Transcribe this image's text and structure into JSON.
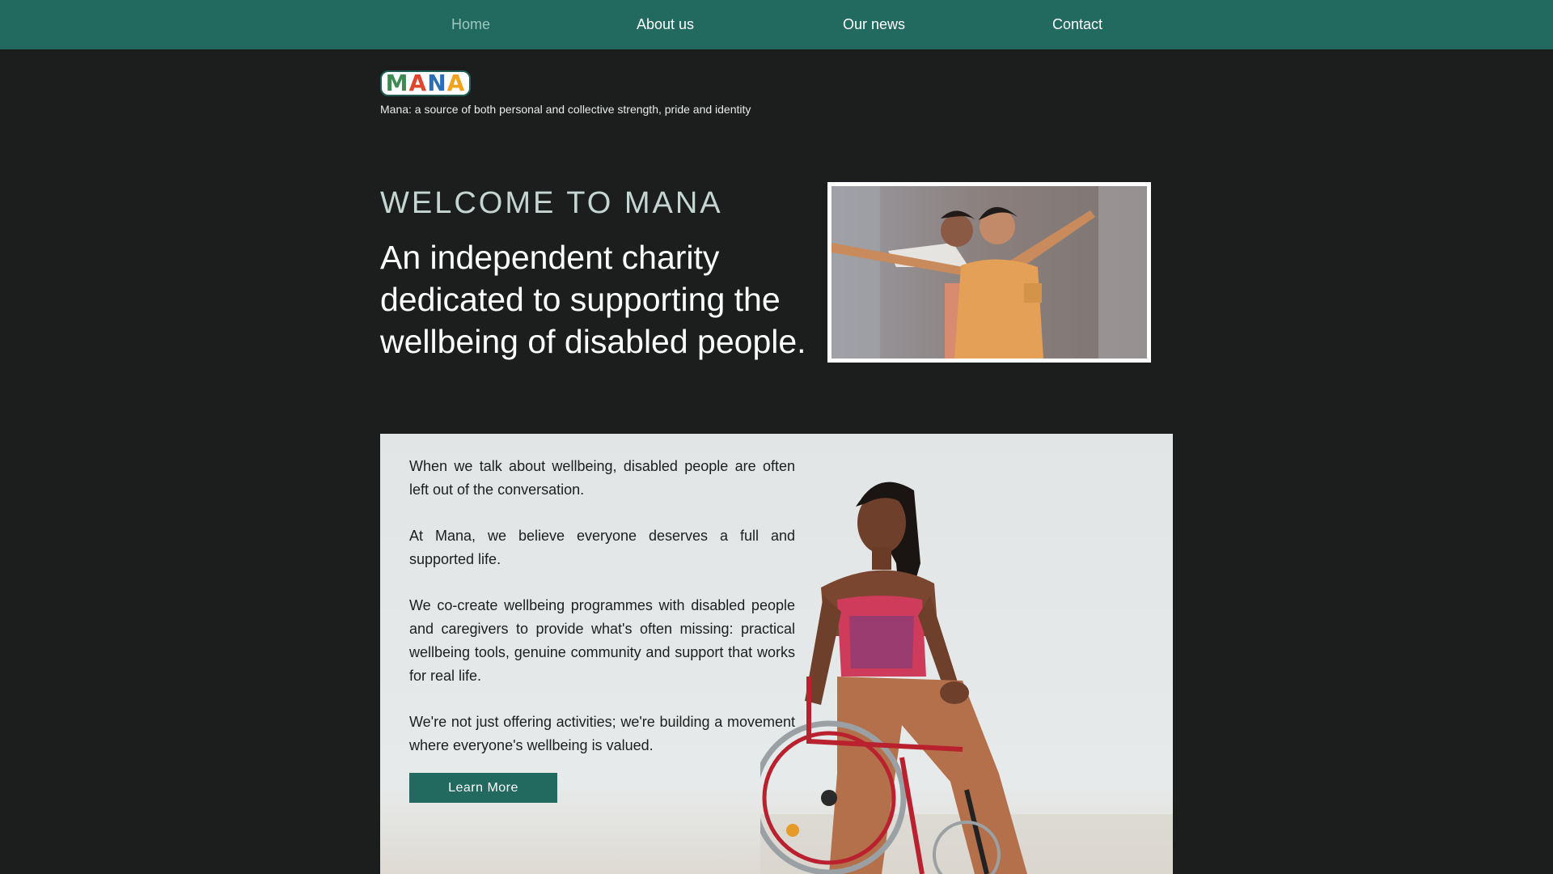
{
  "nav": {
    "items": [
      {
        "label": "Home",
        "active": true
      },
      {
        "label": "About us"
      },
      {
        "label": "Our news"
      },
      {
        "label": "Contact"
      }
    ]
  },
  "brand": {
    "logo_text": "MANA",
    "tagline": "Mana: a source of both personal and collective strength, pride and identity"
  },
  "hero": {
    "kicker": "WELCOME TO MANA",
    "title": "An independent charity dedicated to supporting the wellbeing of disabled people."
  },
  "intro": {
    "paragraphs": [
      "When we talk about wellbeing, disabled people are often left out of the conversation.",
      "At Mana, we believe everyone deserves a full and supported life.",
      "We co-create wellbeing programmes with disabled people and caregivers to provide what's often missing: practical wellbeing tools, genuine community and support that works for real life.",
      "We're not just offering activities; we're building a movement where everyone's wellbeing is valued."
    ],
    "button_label": "Learn More"
  },
  "colors": {
    "nav_bg": "#226a5f",
    "page_bg": "#1b1e1d",
    "accent": "#226a5f"
  }
}
